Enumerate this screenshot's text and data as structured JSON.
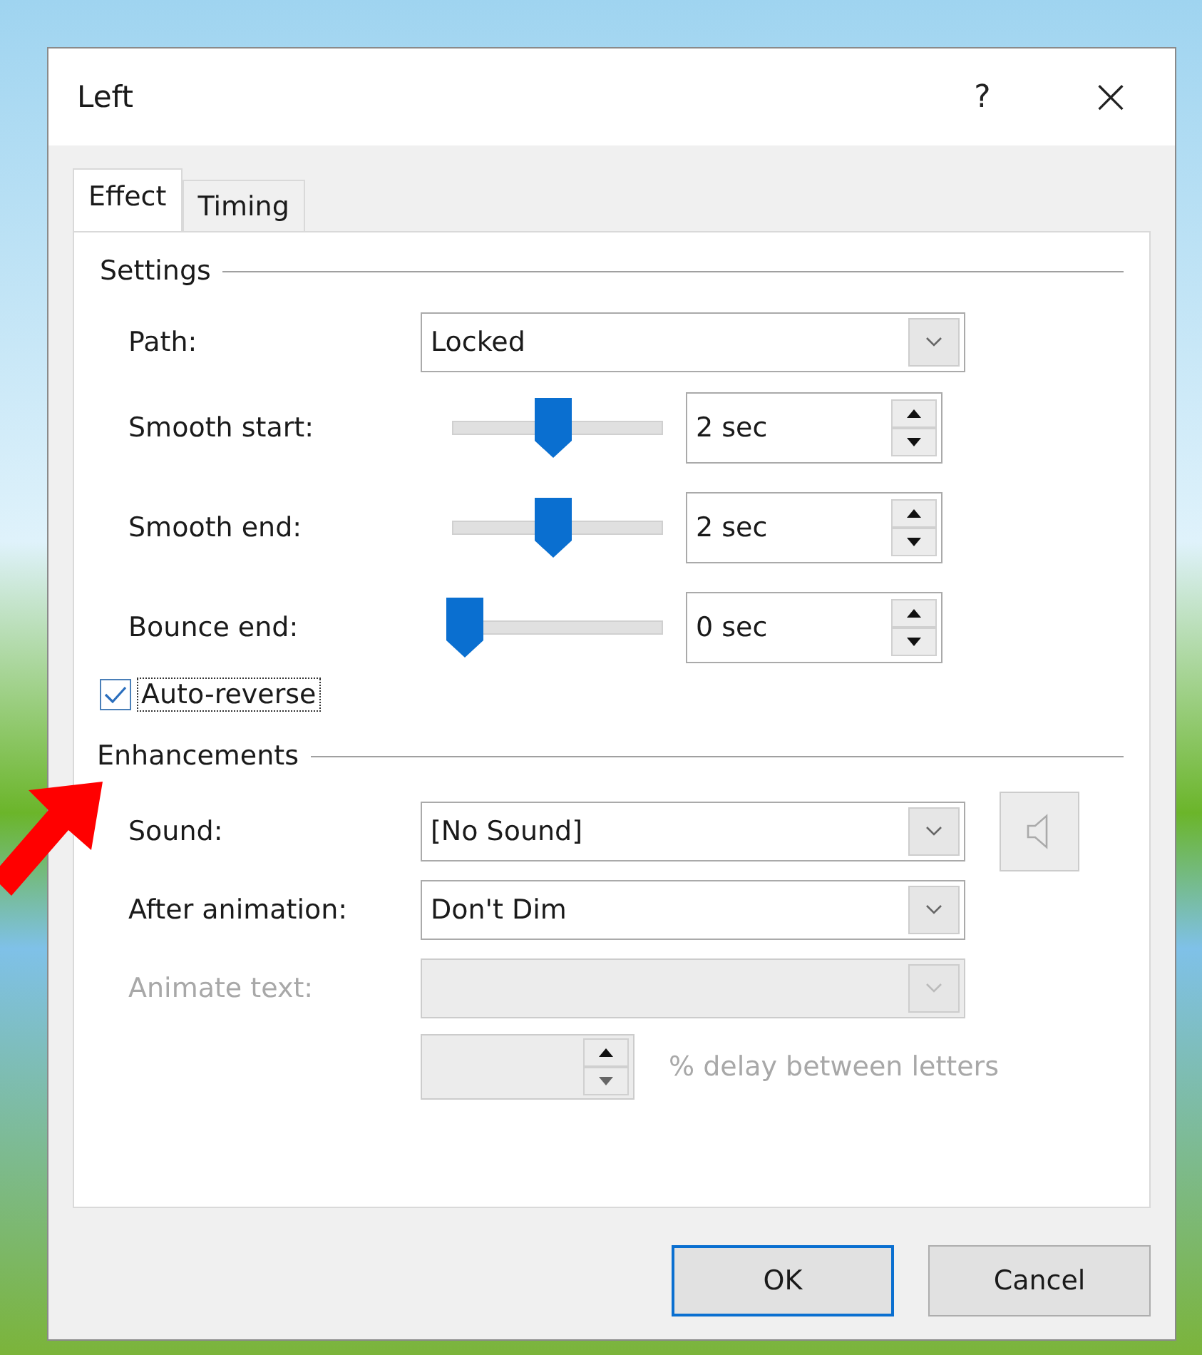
{
  "dialog": {
    "title": "Left",
    "help": "?",
    "close": "×"
  },
  "tabs": [
    {
      "label": "Effect",
      "selected": true
    },
    {
      "label": "Timing",
      "selected": false
    }
  ],
  "settings": {
    "heading": "Settings",
    "path": {
      "label": "Path:",
      "value": "Locked"
    },
    "sliders": [
      {
        "label": "Smooth start:",
        "level": 0.5,
        "value": "2 sec"
      },
      {
        "label": "Smooth end:",
        "level": 0.5,
        "value": "2 sec"
      },
      {
        "label": "Bounce end:",
        "level": 0,
        "value": "0 sec"
      }
    ],
    "auto_reverse": {
      "label": "Auto-reverse",
      "checked": true
    }
  },
  "enhancements": {
    "heading": "Enhancements",
    "rows": [
      {
        "label": "Sound:",
        "value": "[No Sound]",
        "disabled": false,
        "sound_button": true
      },
      {
        "label": "After animation:",
        "value": "Don't Dim",
        "disabled": false,
        "sound_button": false
      },
      {
        "label": "Animate text:",
        "value": "",
        "disabled": true,
        "sound_button": false
      }
    ],
    "delay": {
      "label": "% delay between letters",
      "disabled": true
    }
  },
  "buttons": [
    {
      "label": "OK",
      "selected": true
    },
    {
      "label": "Cancel",
      "selected": false
    }
  ]
}
